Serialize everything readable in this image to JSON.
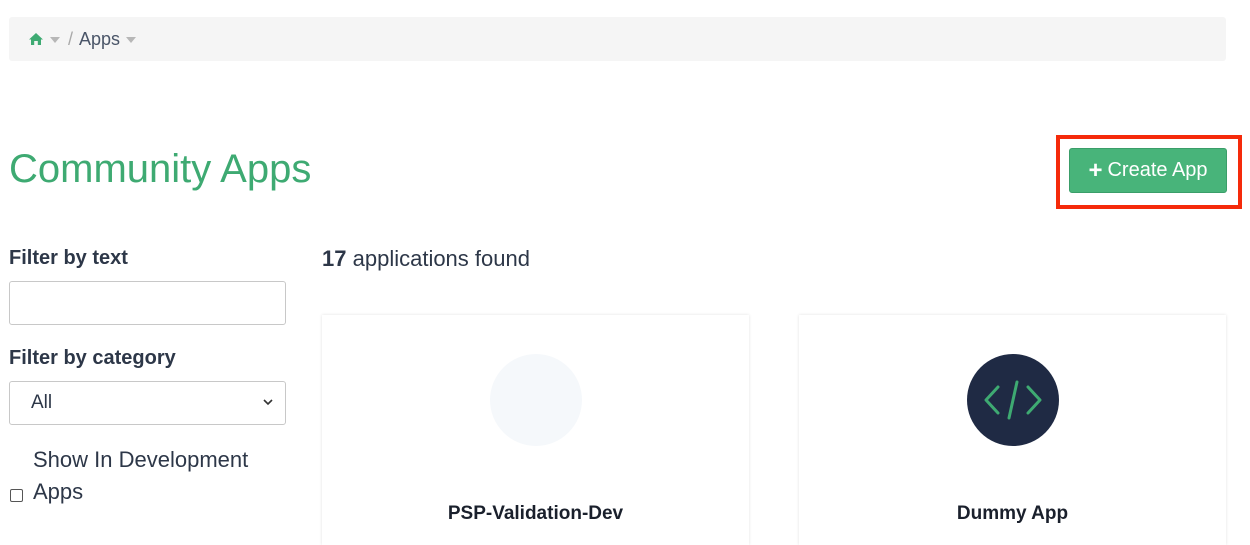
{
  "breadcrumb": {
    "home_icon": "home-icon",
    "separator": "/",
    "current": "Apps"
  },
  "page": {
    "title": "Community Apps"
  },
  "actions": {
    "create_app_icon": "plus-icon",
    "create_app_label": "Create App",
    "highlight_color": "#f52a0a",
    "accent_color": "#48b47a"
  },
  "filters": {
    "text_label": "Filter by text",
    "text_value": "",
    "category_label": "Filter by category",
    "category_selected": "All",
    "dev_apps_label": "Show In Development Apps",
    "dev_apps_checked": false
  },
  "results": {
    "count": "17",
    "count_suffix": "applications found"
  },
  "apps": [
    {
      "name": "PSP-Validation-Dev",
      "logo": "empty-logo"
    },
    {
      "name": "Dummy App",
      "logo": "code-icon"
    }
  ]
}
